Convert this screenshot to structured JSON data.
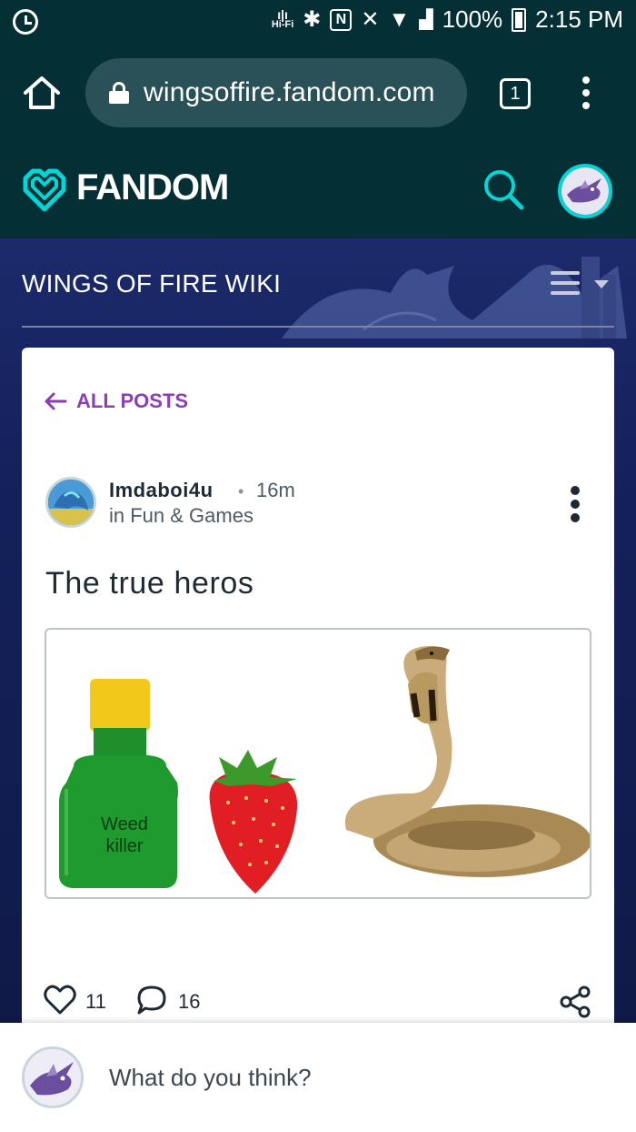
{
  "status_bar": {
    "hifi_label": "Hi-Fi",
    "nfc_label": "N",
    "battery": "100%",
    "time": "2:15 PM"
  },
  "browser": {
    "url": "wingsoffire.fandom.com",
    "tab_count": "1"
  },
  "fandom": {
    "wordmark": "FANDOM",
    "accent_color": "#00d6d6"
  },
  "wiki": {
    "title": "WINGS OF FIRE WIKI"
  },
  "post": {
    "back_label": "ALL POSTS",
    "author": "Imdaboi4u",
    "separator": "•",
    "time": "16m",
    "category": "in Fun & Games",
    "title": "The true heros",
    "image_bottle_label_line1": "Weed",
    "image_bottle_label_line2": "killer",
    "likes": "11",
    "comments": "16"
  },
  "comment_box": {
    "placeholder": "What do you think?"
  },
  "colors": {
    "header_bg": "#042f35",
    "link_purple": "#8b3eb8",
    "banner_blue": "#1c2a6b"
  }
}
